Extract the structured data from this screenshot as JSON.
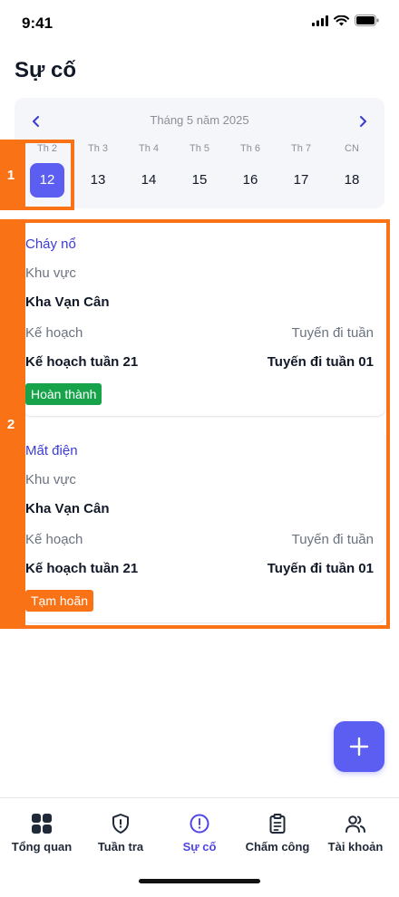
{
  "status": {
    "time": "9:41"
  },
  "page": {
    "title": "Sự cố"
  },
  "calendar": {
    "month_label": "Tháng 5 năm 2025",
    "prev_icon": "chevron-left-icon",
    "next_icon": "chevron-right-icon",
    "days": [
      {
        "dow": "Th 2",
        "date": "12",
        "selected": true
      },
      {
        "dow": "Th 3",
        "date": "13"
      },
      {
        "dow": "Th 4",
        "date": "14"
      },
      {
        "dow": "Th 5",
        "date": "15"
      },
      {
        "dow": "Th 6",
        "date": "16"
      },
      {
        "dow": "Th 7",
        "date": "17"
      },
      {
        "dow": "CN",
        "date": "18"
      }
    ]
  },
  "annotations": {
    "one": "1",
    "two": "2",
    "color": "#f97316"
  },
  "incidents": [
    {
      "title": "Cháy nổ",
      "area_label": "Khu vực",
      "area_value": "Kha Vạn Cân",
      "plan_label": "Kế hoạch",
      "route_label": "Tuyến đi tuần",
      "plan_value": "Kế hoạch tuần 21",
      "route_value": "Tuyến đi tuần 01",
      "status": "Hoàn thành",
      "status_color": "#16a34a"
    },
    {
      "title": "Mất điện",
      "area_label": "Khu vực",
      "area_value": "Kha Vạn Cân",
      "plan_label": "Kế hoạch",
      "route_label": "Tuyến đi tuần",
      "plan_value": "Kế hoạch tuần 21",
      "route_value": "Tuyến đi tuần 01",
      "status": "Tạm hoãn",
      "status_color": "#f97316"
    }
  ],
  "fab": {
    "icon": "plus-icon"
  },
  "nav": {
    "items": [
      {
        "label": "Tổng quan",
        "icon": "grid-icon"
      },
      {
        "label": "Tuần tra",
        "icon": "shield-icon"
      },
      {
        "label": "Sự cố",
        "icon": "alert-circle-icon",
        "active": true
      },
      {
        "label": "Chấm công",
        "icon": "clipboard-icon"
      },
      {
        "label": "Tài khoản",
        "icon": "users-icon"
      }
    ]
  },
  "colors": {
    "accent": "#5b5ef0",
    "link": "#3b3bd6",
    "nav_active": "#4f46e5"
  }
}
